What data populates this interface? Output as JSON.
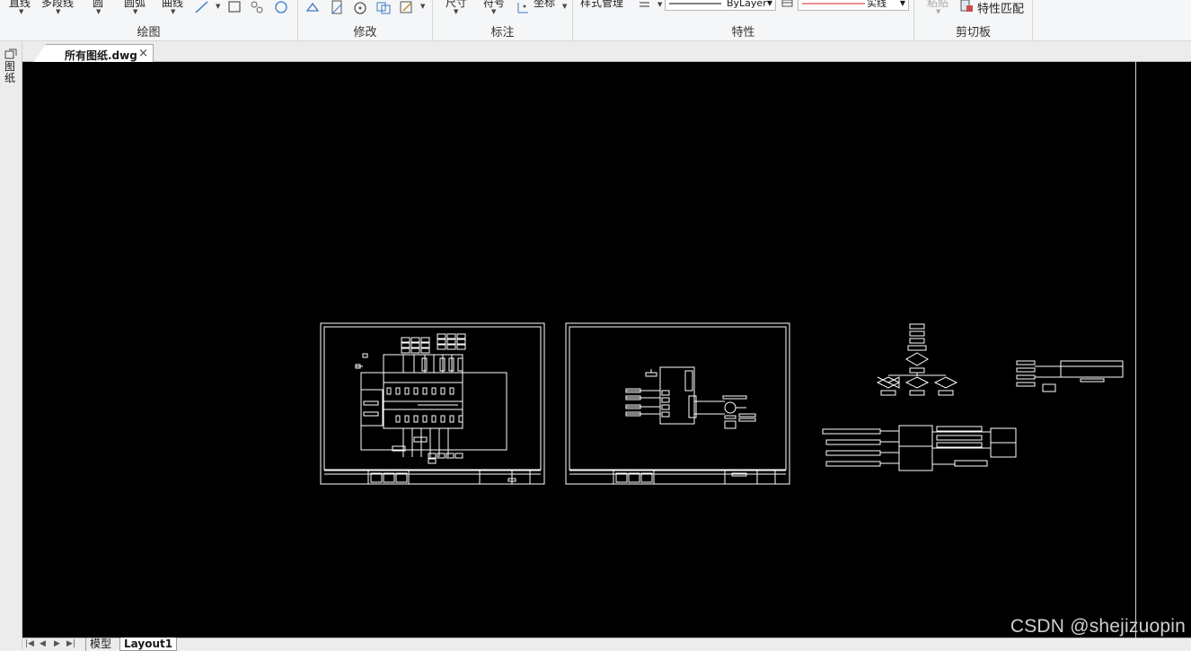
{
  "ribbon": {
    "draw_panel": {
      "title": "绘图",
      "line_label": "直线",
      "polyline_label": "多段线",
      "circle_label": "圆",
      "arc_label": "圆弧",
      "curve_label": "曲线"
    },
    "modify_panel": {
      "title": "修改"
    },
    "annotation_panel": {
      "title": "标注",
      "dimension_label": "尺寸",
      "symbol_label": "符号",
      "coordinate_label": "坐标"
    },
    "properties_panel": {
      "title": "特性",
      "style_manager_label": "样式管理",
      "color_value": "ByLayer",
      "linetype_value": "实线"
    },
    "clipboard_panel": {
      "title": "剪切板",
      "paste_label": "粘贴",
      "match_properties_label": "特性匹配"
    }
  },
  "side_strip": {
    "label": "图纸"
  },
  "document_tab": {
    "label": "所有图纸.dwg",
    "close_glyph": "×"
  },
  "layout_tabs": {
    "model_label": "模型",
    "layout1_label": "Layout1"
  },
  "nav_arrows": [
    "|◀",
    "◀",
    "▶",
    "▶|"
  ],
  "watermark": "CSDN @shejizuopin",
  "colors": {
    "canvas": "#000000",
    "drawing_lines": "#ffffff",
    "ribbon": "#f5f6f7"
  },
  "icons": [
    "line-tool-icon",
    "rectangle-icon",
    "hatch-icon",
    "region-icon",
    "stretch-icon",
    "mirror-icon",
    "rotate-icon",
    "copy-icon",
    "edit-icon",
    "coordinate-icon",
    "linetype-scale-icon",
    "match-properties-icon",
    "close-icon"
  ]
}
